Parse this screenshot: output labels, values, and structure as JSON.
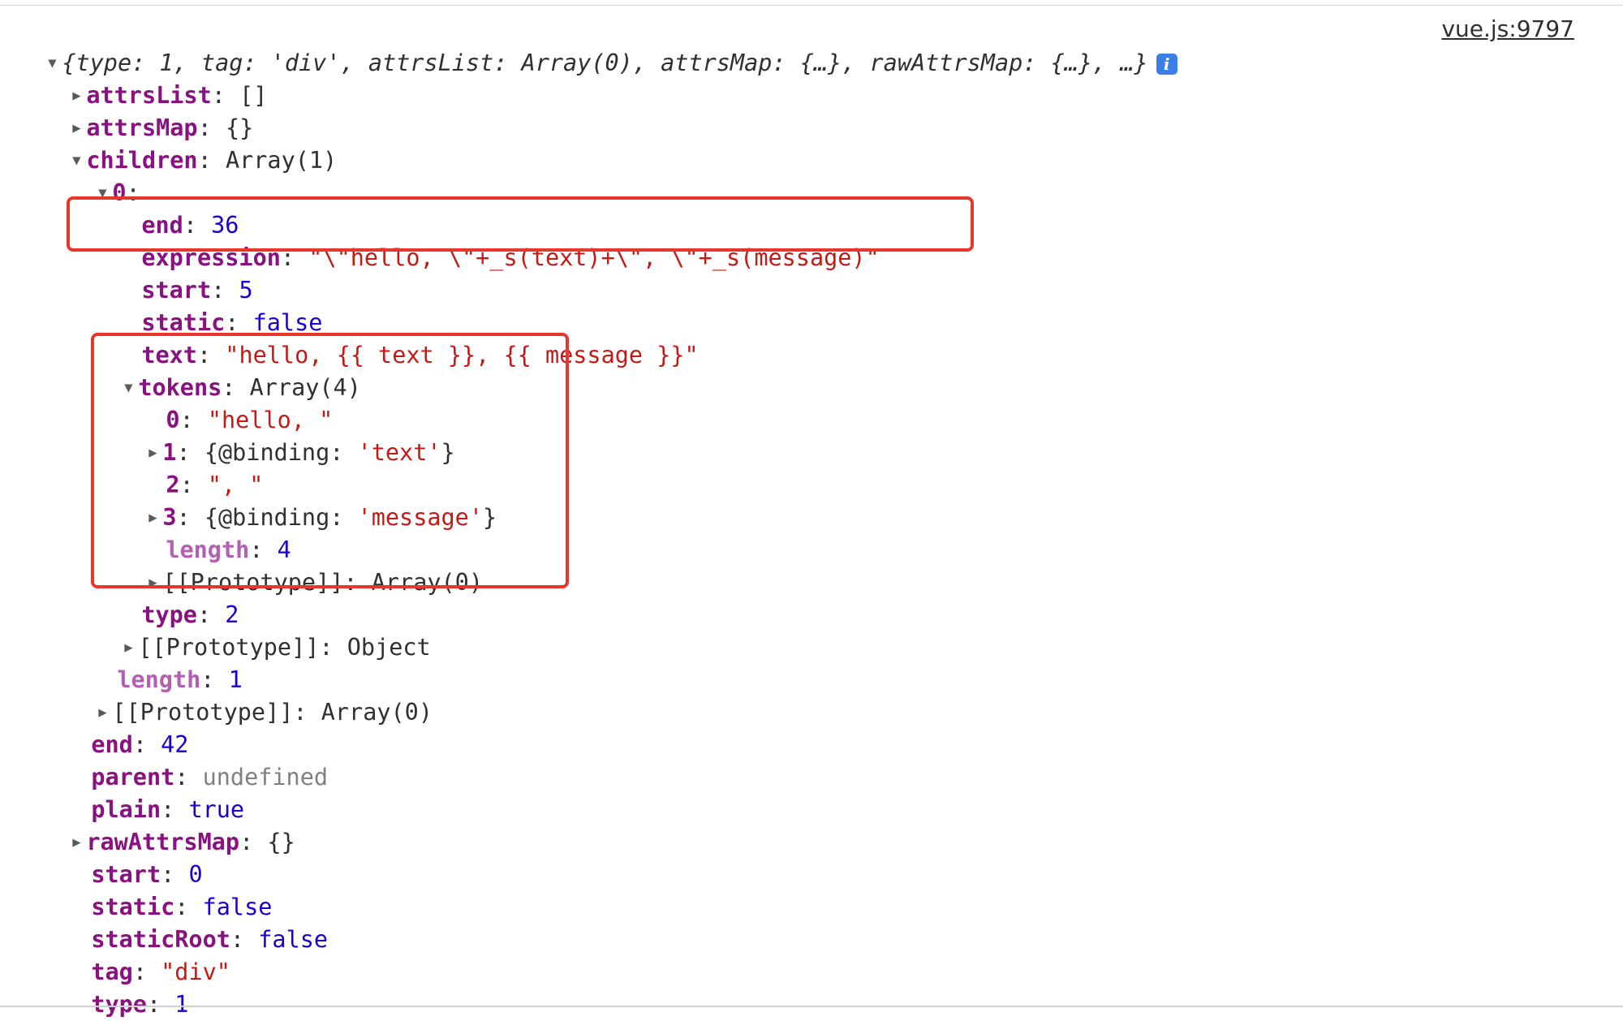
{
  "console": {
    "source_link": "vue.js:9797",
    "summary": "{type: 1, tag: 'div', attrsList: Array(0), attrsMap: {…}, rawAttrsMap: {…}, …}",
    "info_badge": "i",
    "highlight_color": "#e7372c",
    "rows": [
      {
        "label": "attrsList",
        "value": "[]"
      },
      {
        "label": "attrsMap",
        "value": "{}"
      },
      {
        "label": "children",
        "value": "Array(1)"
      },
      {
        "label": "0",
        "value": ""
      },
      {
        "label": "end",
        "value": "36"
      },
      {
        "label": "expression",
        "value": "\"\\\"hello, \\\"+_s(text)+\\\", \\\"+_s(message)\""
      },
      {
        "label": "start",
        "value": "5"
      },
      {
        "label": "static",
        "value": "false"
      },
      {
        "label": "text",
        "value": "\"hello, {{ text }}, {{ message }}\""
      },
      {
        "label": "tokens",
        "value": "Array(4)"
      },
      {
        "label": "0",
        "value": "\"hello, \""
      },
      {
        "label": "1",
        "value_prefix": "{@binding: ",
        "value_str": "'text'",
        "value_suffix": "}"
      },
      {
        "label": "2",
        "value": "\", \""
      },
      {
        "label": "3",
        "value_prefix": "{@binding: ",
        "value_str": "'message'",
        "value_suffix": "}"
      },
      {
        "label": "length",
        "value": "4"
      },
      {
        "label": "[[Prototype]]",
        "value": "Array(0)"
      },
      {
        "label": "type",
        "value": "2"
      },
      {
        "label": "[[Prototype]]",
        "value": "Object"
      },
      {
        "label": "length",
        "value": "1"
      },
      {
        "label": "[[Prototype]]",
        "value": "Array(0)"
      },
      {
        "label": "end",
        "value": "42"
      },
      {
        "label": "parent",
        "value": "undefined"
      },
      {
        "label": "plain",
        "value": "true"
      },
      {
        "label": "rawAttrsMap",
        "value": "{}"
      },
      {
        "label": "start",
        "value": "0"
      },
      {
        "label": "static",
        "value": "false"
      },
      {
        "label": "staticRoot",
        "value": "false"
      },
      {
        "label": "tag",
        "value": "\"div\""
      },
      {
        "label": "type",
        "value": "1"
      }
    ]
  }
}
